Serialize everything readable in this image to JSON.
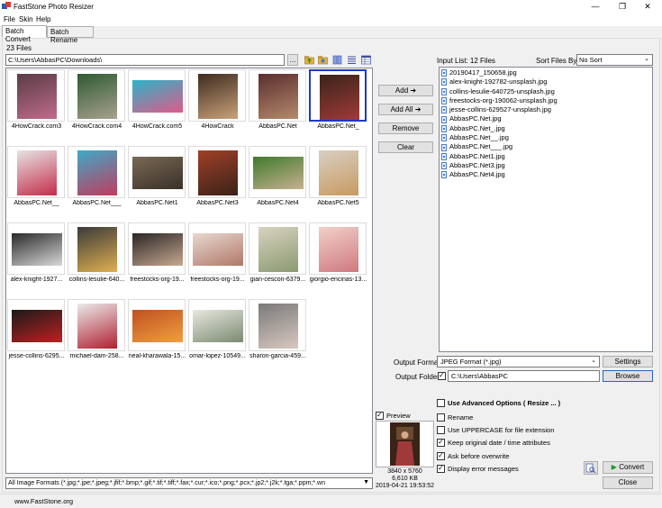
{
  "window": {
    "title": "FastStone Photo Resizer",
    "minimize": "—",
    "restore": "❐",
    "close": "✕"
  },
  "menu": [
    "File",
    "Skin",
    "Help"
  ],
  "tabs": [
    {
      "label": "Batch Convert",
      "active": true
    },
    {
      "label": "Batch Rename",
      "active": false
    }
  ],
  "browser": {
    "file_count": "23 Files",
    "path": "C:\\Users\\AbbasPC\\Downloads\\",
    "browse_label": "...",
    "format_filter": "All Image Formats (*.jpg;*.jpe;*.jpeg;*.jfif;*.bmp;*.gif;*.tif;*.tiff;*.fax;*.cur;*.ico;*.png;*.pcx;*.jp2;*.j2k;*.tga;*.ppm;*.wn"
  },
  "thumbnails": [
    {
      "caption": "4HowCrack.com3",
      "colors": [
        "#5a3c46",
        "#c06b8b"
      ],
      "selected": false,
      "landscape": false
    },
    {
      "caption": "4HowCrack.com4",
      "colors": [
        "#2f5a32",
        "#a8a18e"
      ],
      "selected": false,
      "landscape": false
    },
    {
      "caption": "4HowCrack.com5",
      "colors": [
        "#2bb4c8",
        "#e05a8a"
      ],
      "selected": false,
      "landscape": true
    },
    {
      "caption": "4HowCrack",
      "colors": [
        "#3e2b20",
        "#c9a27a"
      ],
      "selected": false,
      "landscape": false
    },
    {
      "caption": "AbbasPC.Net",
      "colors": [
        "#5a2e2e",
        "#b48a6c"
      ],
      "selected": false,
      "landscape": false
    },
    {
      "caption": "AbbasPC.Net_",
      "colors": [
        "#3a2418",
        "#a03a3a"
      ],
      "selected": true,
      "landscape": false
    },
    {
      "caption": "AbbasPC.Net__",
      "colors": [
        "#e6e3e3",
        "#c42d4a"
      ],
      "selected": false,
      "landscape": false
    },
    {
      "caption": "AbbasPC.Net___",
      "colors": [
        "#3fa9c9",
        "#c03b5c"
      ],
      "selected": false,
      "landscape": false
    },
    {
      "caption": "AbbasPC.Net1",
      "colors": [
        "#7a6a55",
        "#3a3028"
      ],
      "selected": false,
      "landscape": true
    },
    {
      "caption": "AbbasPC.Net3",
      "colors": [
        "#a04028",
        "#3a2218"
      ],
      "selected": false,
      "landscape": false
    },
    {
      "caption": "AbbasPC.Net4",
      "colors": [
        "#3f7a2c",
        "#c8b090"
      ],
      "selected": false,
      "landscape": true
    },
    {
      "caption": "AbbasPC.Net5",
      "colors": [
        "#d8cfc4",
        "#c89a60"
      ],
      "selected": false,
      "landscape": false
    },
    {
      "caption": "alex-knight-1927...",
      "colors": [
        "#2a2a2a",
        "#d8d8d8"
      ],
      "selected": false,
      "landscape": true
    },
    {
      "caption": "collins-lesulie-640...",
      "colors": [
        "#3a3a3a",
        "#e0b050"
      ],
      "selected": false,
      "landscape": false
    },
    {
      "caption": "freestocks-org-19...",
      "colors": [
        "#2a2626",
        "#c8a890"
      ],
      "selected": false,
      "landscape": true
    },
    {
      "caption": "freestocks-org-19...",
      "colors": [
        "#e8d8d0",
        "#b07868"
      ],
      "selected": false,
      "landscape": true
    },
    {
      "caption": "gian-cescon-6379...",
      "colors": [
        "#d8d2c0",
        "#8a9a70"
      ],
      "selected": false,
      "landscape": false
    },
    {
      "caption": "giorgio-encinas-13...",
      "colors": [
        "#f0d0c8",
        "#d07880"
      ],
      "selected": false,
      "landscape": false
    },
    {
      "caption": "jesse-collins-6295...",
      "colors": [
        "#1a1a1a",
        "#c02020"
      ],
      "selected": false,
      "landscape": true
    },
    {
      "caption": "michael-dam-258...",
      "colors": [
        "#eaeaea",
        "#b02030"
      ],
      "selected": false,
      "landscape": false
    },
    {
      "caption": "neal-kharawala-15...",
      "colors": [
        "#c05020",
        "#f0a040"
      ],
      "selected": false,
      "landscape": true
    },
    {
      "caption": "omar-lopez-10549...",
      "colors": [
        "#e8e8e0",
        "#7a8a70"
      ],
      "selected": false,
      "landscape": true
    },
    {
      "caption": "sharon-garcia-459...",
      "colors": [
        "#7a7a7a",
        "#d8c8c0"
      ],
      "selected": false,
      "landscape": false
    }
  ],
  "middle_buttons": {
    "add": "Add ➜",
    "add_all": "Add All ➜",
    "remove": "Remove",
    "clear": "Clear"
  },
  "input_list": {
    "label": "Input List:  12 Files",
    "sort_label": "Sort Files By:",
    "sort_value": "No Sort",
    "items": [
      "20190417_150658.jpg",
      "alex-knight-192782-unsplash.jpg",
      "collins-lesulie-640725-unsplash.jpg",
      "freestocks-org-190062-unsplash.jpg",
      "jesse-collins-629527-unsplash.jpg",
      "AbbasPC.Net.jpg",
      "AbbasPC.Net_.jpg",
      "AbbasPC.Net__.jpg",
      "AbbasPC.Net___.jpg",
      "AbbasPC.Net1.jpg",
      "AbbasPC.Net3.jpg",
      "AbbasPC.Net4.jpg"
    ]
  },
  "output": {
    "format_label": "Output Format:",
    "format_value": "JPEG Format (*.jpg)",
    "settings_label": "Settings",
    "folder_label": "Output Folder:",
    "folder_value": "C:\\Users\\AbbasPC",
    "browse_label": "Browse"
  },
  "options": [
    {
      "label": "Use Advanced Options ( Resize ... )",
      "checked": false,
      "bold": true
    },
    {
      "label": "Rename",
      "checked": false,
      "bold": false
    },
    {
      "label": "Use UPPERCASE for file extension",
      "checked": false,
      "bold": false
    },
    {
      "label": "Keep original date / time attributes",
      "checked": true,
      "bold": false
    },
    {
      "label": "Ask before overwrite",
      "checked": true,
      "bold": false
    },
    {
      "label": "Display error messages",
      "checked": true,
      "bold": false
    }
  ],
  "preview": {
    "label": "Preview",
    "checked": true,
    "dimensions": "3840 x 5760",
    "size": "6,610 KB",
    "date": "2019-04-21 19:53:52"
  },
  "actions": {
    "convert": "Convert",
    "close": "Close"
  },
  "status": {
    "website": "www.FastStone.org"
  },
  "colors": {
    "accent_selected": "#1d39c4",
    "convert_green": "#1a9c2c"
  }
}
